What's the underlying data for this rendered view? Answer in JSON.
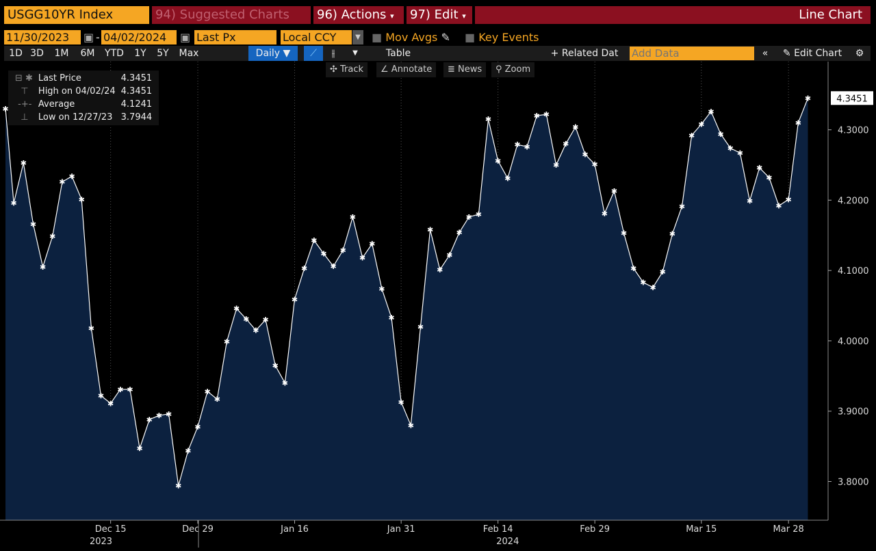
{
  "header": {
    "ticker": "USGG10YR Index",
    "suggested": "94) Suggested Charts",
    "actions": "96) Actions",
    "edit": "97) Edit",
    "chart_type": "Line Chart"
  },
  "controls": {
    "start_date": "11/30/2023",
    "end_date": "04/02/2024",
    "field": "Last Px",
    "currency": "Local CCY",
    "mov_avgs": "Mov Avgs",
    "key_events": "Key Events",
    "periods": [
      "1D",
      "3D",
      "1M",
      "6M",
      "YTD",
      "1Y",
      "5Y",
      "Max"
    ],
    "frequency": "Daily ▼",
    "table": "Table",
    "related": "+ Related Dat",
    "add_data_placeholder": "Add Data",
    "edit_chart": "Edit Chart"
  },
  "tools": {
    "track": "Track",
    "annotate": "Annotate",
    "news": "News",
    "zoom": "Zoom"
  },
  "legend": [
    {
      "label": "Last Price",
      "value": "4.3451"
    },
    {
      "label": "High on 04/02/24",
      "value": "4.3451"
    },
    {
      "label": "Average",
      "value": "4.1241"
    },
    {
      "label": "Low on 12/27/23",
      "value": "3.7944"
    }
  ],
  "colors": {
    "accent": "#f5a623",
    "header_red": "#8b1020",
    "fill": "#0c213f",
    "line": "#ffffff"
  },
  "chart_data": {
    "type": "area",
    "series": [
      {
        "values": [
          4.33,
          4.196,
          4.253,
          4.166,
          4.105,
          4.149,
          4.226,
          4.234,
          4.201,
          4.018,
          3.922,
          3.911,
          3.931,
          3.931,
          3.847,
          3.888,
          3.894,
          3.896,
          3.794,
          3.844,
          3.878,
          3.928,
          3.917,
          3.999,
          4.046,
          4.031,
          4.015,
          4.03,
          3.965,
          3.94,
          4.059,
          4.103,
          4.143,
          4.124,
          4.106,
          4.129,
          4.176,
          4.118,
          4.138,
          4.074,
          4.033,
          3.913,
          3.88,
          4.02,
          4.158,
          4.101,
          4.122,
          4.154,
          4.176,
          4.18,
          4.315,
          4.256,
          4.231,
          4.279,
          4.276,
          4.32,
          4.322,
          4.25,
          4.28,
          4.304,
          4.265,
          4.251,
          4.181,
          4.213,
          4.153,
          4.103,
          4.083,
          4.076,
          4.098,
          4.152,
          4.191,
          4.292,
          4.308,
          4.326,
          4.294,
          4.274,
          4.267,
          4.199,
          4.246,
          4.232,
          4.192,
          4.201,
          4.31,
          4.3451
        ]
      }
    ],
    "x_ticks": [
      {
        "index": 11,
        "label": "Dec 15"
      },
      {
        "index": 20,
        "label": "Dec 29"
      },
      {
        "index": 30,
        "label": "Jan 16"
      },
      {
        "index": 41,
        "label": "Jan 31"
      },
      {
        "index": 51,
        "label": "Feb 14"
      },
      {
        "index": 61,
        "label": "Feb 29"
      },
      {
        "index": 72,
        "label": "Mar 15"
      },
      {
        "index": 81,
        "label": "Mar 28"
      }
    ],
    "years": [
      {
        "index": 10,
        "label": "2023"
      },
      {
        "index": 52,
        "label": "2024"
      }
    ],
    "y_ticks": [
      "3.8000",
      "3.9000",
      "4.0000",
      "4.1000",
      "4.2000",
      "4.3000"
    ],
    "ylim": [
      3.745,
      4.395
    ],
    "last_label": "4.3451",
    "grid": "vertical dotted"
  }
}
